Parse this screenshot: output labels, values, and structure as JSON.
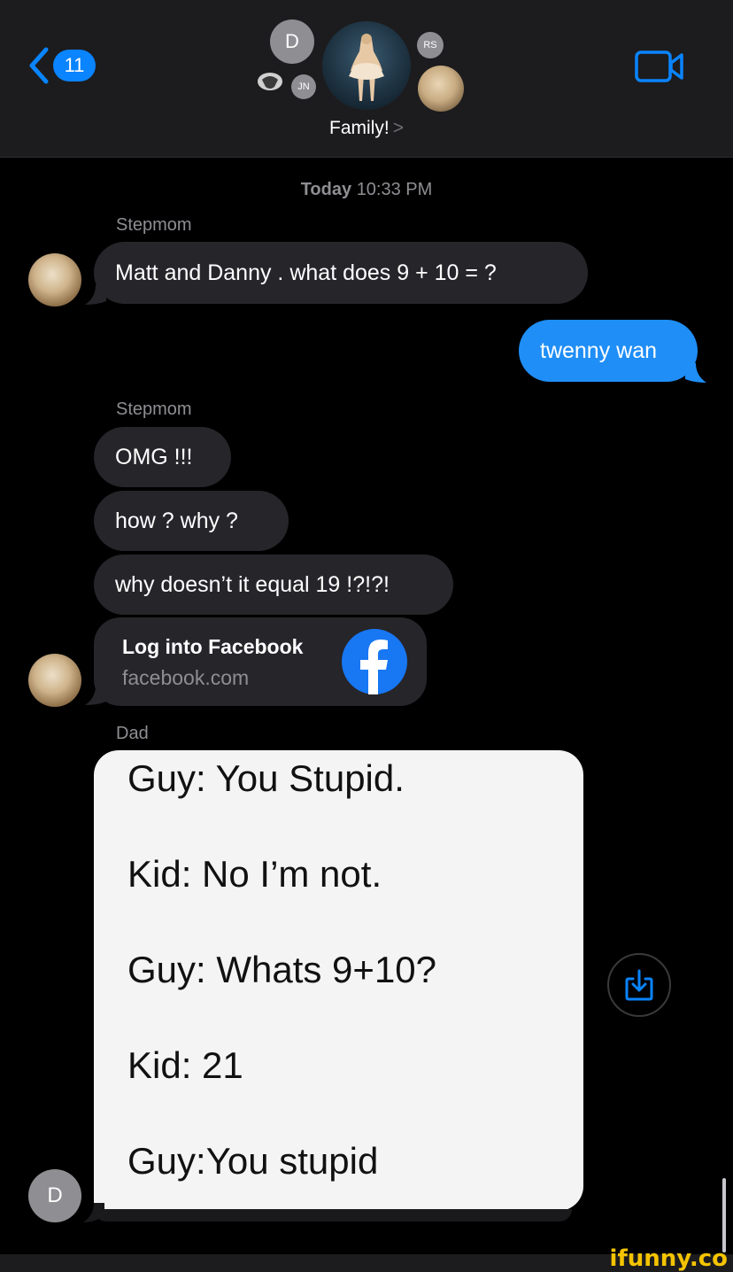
{
  "header": {
    "back_count": "11",
    "group_name": "Family!",
    "chevron": ">",
    "avatars": {
      "d_initial": "D",
      "rs_initials": "RS",
      "jn_initials": "JN"
    }
  },
  "conversation": {
    "timestamp_day": "Today",
    "timestamp_time": "10:33 PM",
    "sender_stepmom_1": "Stepmom",
    "msg_1": "Matt and Danny . what does  9 + 10 = ?",
    "my_reply": "twenny wan",
    "sender_stepmom_2": "Stepmom",
    "msg_2": "OMG !!!",
    "msg_3": "how ? why ?",
    "msg_4": "why doesn’t it equal 19 !?!?!",
    "link": {
      "title": "Log into Facebook",
      "url": "facebook.com"
    },
    "sender_dad": "Dad",
    "dad_initial": "D",
    "image_text": [
      "Guy: You Stupid.",
      "Kid: No I’m not.",
      "Guy: Whats 9+10?",
      "Kid: 21",
      "Guy:You stupid"
    ]
  },
  "watermark": "ifunny.co",
  "colors": {
    "accent": "#0a84ff",
    "my_bubble": "#1f8ef7",
    "their_bubble": "#26252a",
    "background": "#000000"
  }
}
